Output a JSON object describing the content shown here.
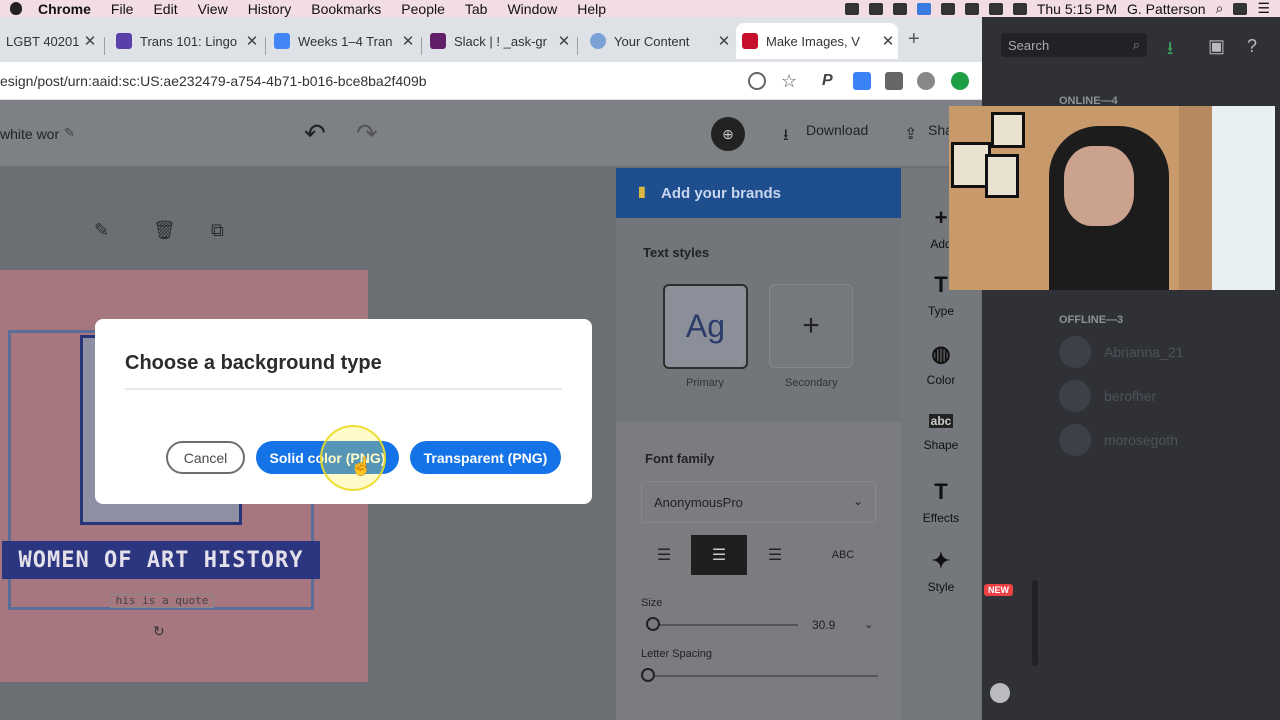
{
  "menubar": {
    "app": "Chrome",
    "items": [
      "File",
      "Edit",
      "View",
      "History",
      "Bookmarks",
      "People",
      "Tab",
      "Window",
      "Help"
    ],
    "clock": "Thu 5:15 PM",
    "user": "G. Patterson"
  },
  "browser": {
    "tabs": [
      {
        "label": "LGBT 40201",
        "color": "#888888"
      },
      {
        "label": "Trans 101: Lingo",
        "color": "#5b3fa8"
      },
      {
        "label": "Weeks 1–4 Tran",
        "color": "#4285f4"
      },
      {
        "label": "Slack | ! _ask-gr",
        "color": "#611f69"
      },
      {
        "label": "Your Content",
        "color": "#7aa2d6"
      },
      {
        "label": "Make Images, V",
        "color": "#c8102e"
      }
    ],
    "new_tab": "+",
    "url": "esign/post/urn:aaid:sc:US:ae232479-a754-4b71-b016-bce8ba2f409b"
  },
  "editor": {
    "doc_title": "white wor",
    "download": "Download",
    "share": "Sha",
    "brand_bar": "Add your brands",
    "text_styles": "Text styles",
    "style_primary_glyph": "Ag",
    "style_primary": "Primary",
    "style_secondary_glyph": "+",
    "style_secondary": "Secondary",
    "font_family_label": "Font family",
    "font_family_value": "AnonymousPro",
    "size_label": "Size",
    "size_value": "30.9",
    "letter_spacing_label": "Letter Spacing",
    "poster_title": "WOMEN OF ART HISTORY",
    "poster_quote": "his is a quote",
    "rail": [
      "Add",
      "Type",
      "Color",
      "Shape",
      "Effects",
      "Style"
    ]
  },
  "dialog": {
    "title": "Choose a background type",
    "cancel": "Cancel",
    "solid": "Solid color (PNG)",
    "transparent": "Transparent (PNG)"
  },
  "discord": {
    "search_placeholder": "Search",
    "online_header": "ONLINE—4",
    "offline_header": "OFFLINE—3",
    "offline_users": [
      "Abrianna_21",
      "berofher",
      "morosegoth"
    ],
    "new_badge": "NEW"
  }
}
